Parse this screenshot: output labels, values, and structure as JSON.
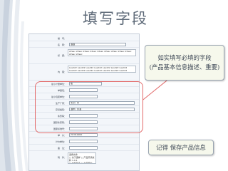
{
  "slide": {
    "title": "填写字段",
    "callout_required": [
      "如实填写必填的字段",
      "(产品基本信息描述、重要)"
    ],
    "callout_save": "记得 保存产品信息"
  },
  "form": {
    "rows": [
      {
        "label": "编　号：",
        "value": "",
        "type": "input"
      },
      {
        "label": "名　称：",
        "value": "酒酒",
        "type": "input"
      },
      {
        "label": "标　题：",
        "value": "22sec 22sec 22sec 22sec 22sec 22sec 22sec 22sec 22sec 22sec 22sec",
        "type": "box"
      },
      {
        "label": "内　容：",
        "value": "Lasd22 Lasd22 Lasd22 Lasd22 Lasd22 Lasd22 Lasd22 Lasd22 Lasd22 Lasd22 Lasd22 Lasd22 Lasd22 Lasd22",
        "type": "box"
      },
      {
        "label": "最小计量单位：",
        "value": "瓶",
        "type": "input"
      },
      {
        "label": "单量包：",
        "value": "",
        "type": "input"
      },
      {
        "label": "最小包装单位：",
        "value": "",
        "type": "input"
      },
      {
        "label": "生产厂家：",
        "value": "北京厂家",
        "type": "input"
      },
      {
        "label": "存货编码：",
        "value": "酒样厂家酒",
        "type": "input"
      },
      {
        "label": "条形码：",
        "value": "",
        "type": "input"
      },
      {
        "label": "国际条形码：",
        "value": "",
        "type": "input"
      },
      {
        "label": "国家标准号：",
        "value": "",
        "type": "input"
      },
      {
        "label": "单　价：",
        "value": "2136.0000",
        "type": "input"
      },
      {
        "label": "计价单位：",
        "value": "",
        "type": "input"
      },
      {
        "label": "备　注：",
        "value": "",
        "type": "input"
      },
      {
        "label": "附　件：",
        "value": "选择文件\n□ 关于酒样 □ 产品开通资料 1.0.1\n□ 文件列表 □ 本月报价",
        "type": "box"
      }
    ]
  }
}
